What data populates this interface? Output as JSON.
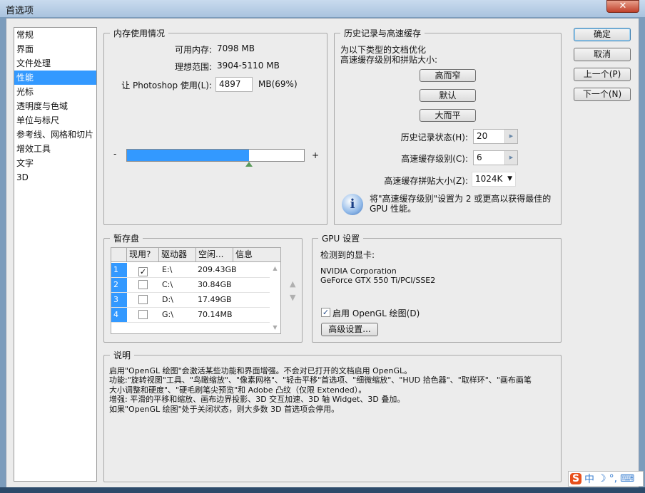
{
  "window": {
    "title": "首选项",
    "close": "✕"
  },
  "sidebar": {
    "items": [
      "常规",
      "界面",
      "文件处理",
      "性能",
      "光标",
      "透明度与色域",
      "单位与标尺",
      "参考线、网格和切片",
      "增效工具",
      "文字",
      "3D"
    ],
    "selected": 3
  },
  "buttons": {
    "ok": "确定",
    "cancel": "取消",
    "prev": "上一个(P)",
    "next": "下一个(N)"
  },
  "memory": {
    "title": "内存使用情况",
    "available_label": "可用内存:",
    "available_value": "7098 MB",
    "ideal_label": "理想范围:",
    "ideal_value": "3904-5110 MB",
    "use_label": "让 Photoshop 使用(L):",
    "use_value": "4897",
    "use_unit": "MB(69%)",
    "slider_percent": 69,
    "minus": "-",
    "plus": "+"
  },
  "history": {
    "title": "历史记录与高速缓存",
    "optimize_line1": "为以下类型的文档优化",
    "optimize_line2": "高速缓存级别和拼贴大小:",
    "btn_tall": "高而窄",
    "btn_default": "默认",
    "btn_big": "大而平",
    "states_label": "历史记录状态(H):",
    "states_value": "20",
    "levels_label": "高速缓存级别(C):",
    "levels_value": "6",
    "tile_label": "高速缓存拼贴大小(Z):",
    "tile_value": "1024K",
    "info_line1": "将\"高速缓存级别\"设置为 2 或更高以获得最佳的",
    "info_line2": "GPU 性能。"
  },
  "scratch": {
    "title": "暂存盘",
    "columns": [
      "现用?",
      "驱动器",
      "空闲...",
      "信息"
    ],
    "rows": [
      {
        "n": "1",
        "active": true,
        "drive": "E:\\",
        "free": "209.43GB"
      },
      {
        "n": "2",
        "active": false,
        "drive": "C:\\",
        "free": "30.84GB"
      },
      {
        "n": "3",
        "active": false,
        "drive": "D:\\",
        "free": "17.49GB"
      },
      {
        "n": "4",
        "active": false,
        "drive": "G:\\",
        "free": "70.14MB"
      }
    ]
  },
  "gpu": {
    "title": "GPU 设置",
    "detected_label": "检测到的显卡:",
    "vendor": "NVIDIA Corporation",
    "card": "GeForce GTX 550 Ti/PCI/SSE2",
    "opengl_label": "启用 OpenGL 绘图(D)",
    "opengl_checked": true,
    "advanced": "高级设置..."
  },
  "description": {
    "title": "说明",
    "lines": [
      "启用\"OpenGL 绘图\"会激活某些功能和界面增强。不会对已打开的文档启用 OpenGL。",
      "功能:\"旋转视图\"工具、\"鸟瞰缩放\"、\"像素网格\"、\"轻击平移\"首选项、\"细微缩放\"、\"HUD 拾色器\"、\"取样环\"、\"画布画笔",
      "大小调整和硬度\"、\"硬毛刷笔尖预览\"和 Adobe 凸纹（仅限 Extended）。",
      "增强: 平滑的平移和缩放、画布边界投影、3D 交互加速、3D 轴 Widget、3D 叠加。",
      "如果\"OpenGL 绘图\"处于关闭状态，则大多数 3D 首选项会停用。"
    ]
  },
  "ime": {
    "logo": "S",
    "mode": "中",
    "moon": "☽",
    "punct": "°,",
    "keyboard": "⌨"
  }
}
